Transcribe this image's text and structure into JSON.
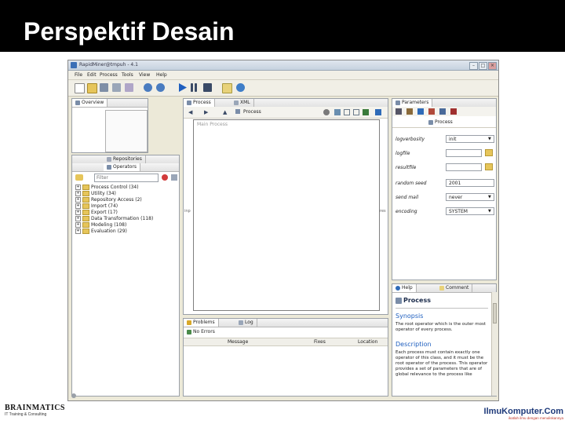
{
  "slide": {
    "title": "Perspektif Desain"
  },
  "window": {
    "title": "RapidMiner@tmpuh - 4.1"
  },
  "menu": [
    "File",
    "Edit",
    "Process",
    "Tools",
    "View",
    "Help"
  ],
  "overview_tab": "Overview",
  "repositories_tab": "Repositories",
  "operators_tab": "Operators",
  "filter_placeholder": "Filter",
  "operator_tree": [
    "Process Control (34)",
    "Utility (34)",
    "Repository Access (2)",
    "Import (74)",
    "Export (17)",
    "Data Transformation (118)",
    "Modeling (108)",
    "Evaluation (29)"
  ],
  "process_tab": "Process",
  "xml_tab": "XML",
  "process_breadcrumb": "Process",
  "main_process_label": "Main Process",
  "port_inp": "inp",
  "port_res": "res",
  "parameters_tab": "Parameters",
  "parameters_header": "Process",
  "parameters": [
    {
      "label": "logverbosity",
      "value": "init"
    },
    {
      "label": "logfile",
      "value": ""
    },
    {
      "label": "resultfile",
      "value": ""
    },
    {
      "label": "random seed",
      "value": "2001"
    },
    {
      "label": "send mail",
      "value": "never"
    },
    {
      "label": "encoding",
      "value": "SYSTEM"
    }
  ],
  "problems_tab": "Problems",
  "log_tab": "Log",
  "no_errors": "No Errors",
  "problems_columns": [
    "Message",
    "Fixes",
    "Location"
  ],
  "help_tab": "Help",
  "comment_tab": "Comment",
  "help": {
    "title": "Process",
    "synopsis_heading": "Synopsis",
    "synopsis_text": "The root operator which is the outer most operator of every process.",
    "description_heading": "Description",
    "description_text": "Each process must contain exactly one operator of this class, and it must be the root operator of the process. This operator provides a set of parameters that are of global relevance to the process like"
  },
  "footer": {
    "left_brand": "BRAINMATICS",
    "left_tagline": "IT Training & Consulting",
    "right_brand": "IlmuKomputer.Com",
    "right_tagline": "ikatlah ilmu dengan menuliskannya"
  },
  "colors": {
    "header_bg": "#000000",
    "header_text": "#ffffff",
    "app_bg": "#ece9d8",
    "accent_blue": "#1f5fbf"
  }
}
